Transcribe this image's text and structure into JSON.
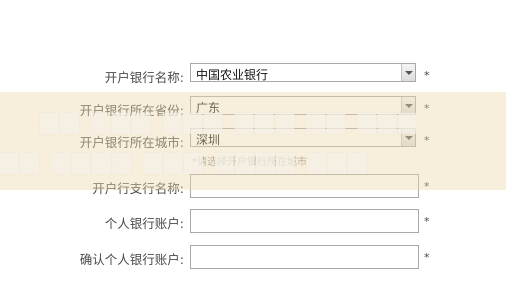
{
  "form": {
    "bank_name": {
      "label": "开户银行名称:",
      "value": "中国农业银行",
      "required": "*"
    },
    "province": {
      "label": "开户银行所在省份:",
      "value": "广东",
      "required": "*"
    },
    "city": {
      "label": "开户银行所在城市:",
      "value": "深圳",
      "required": "*"
    },
    "city_hint": "*请选择开户银行所在城市",
    "branch": {
      "label": "开户行支行名称:",
      "value": "",
      "required": "*"
    },
    "account": {
      "label": "个人银行账户:",
      "value": "",
      "required": "*"
    },
    "confirm_account": {
      "label": "确认个人银行账户:",
      "value": "",
      "required": "*"
    }
  }
}
